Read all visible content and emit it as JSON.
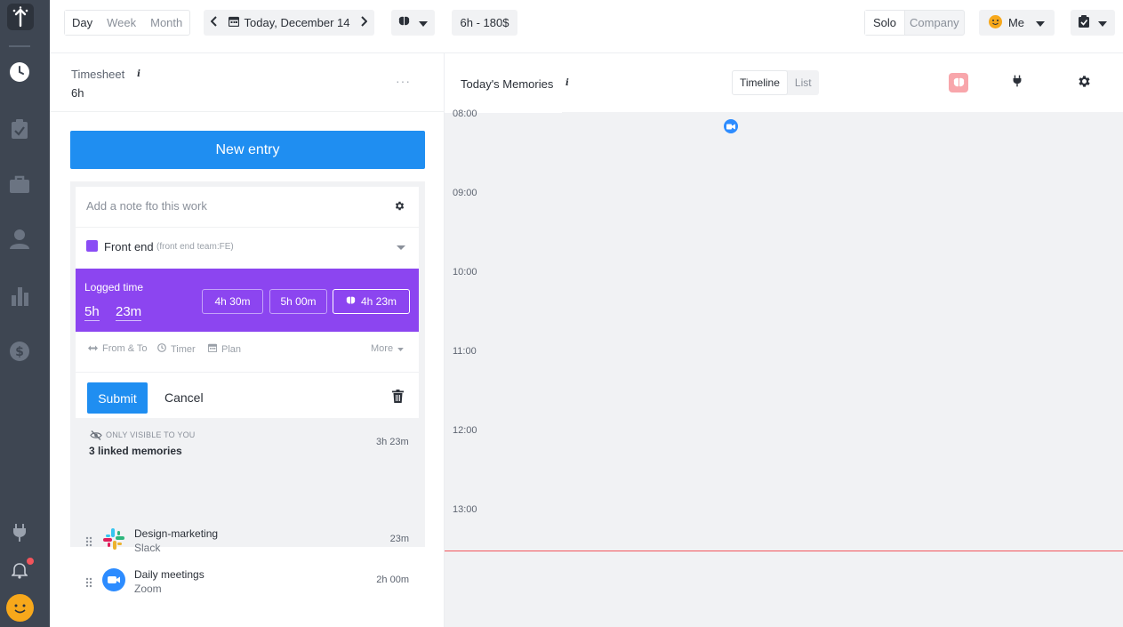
{
  "header": {
    "view_tabs": [
      "Day",
      "Week",
      "Month"
    ],
    "date_label": "Today, December 14",
    "summary": "6h - 180$",
    "scope_tabs": [
      "Solo",
      "Company"
    ],
    "user_label": "Me"
  },
  "timesheet": {
    "title": "Timesheet",
    "info": "i",
    "hours": "6h",
    "more": "···"
  },
  "new_entry_label": "New entry",
  "entry": {
    "note_placeholder": "Add a note fto this work",
    "project_name": "Front end",
    "project_sub": "(front end team:FE)",
    "logged_label": "Logged time",
    "hours": "5h",
    "minutes": "23m",
    "chips": [
      "4h 30m",
      "5h 00m",
      "4h 23m"
    ],
    "modes": [
      "From & To",
      "Timer",
      "Plan"
    ],
    "more_label": "More",
    "submit_label": "Submit",
    "cancel_label": "Cancel"
  },
  "memories_linked": {
    "visibility_text": "ONLY VISIBLE TO YOU",
    "title": "3 linked memories",
    "total": "3h 23m",
    "items": [
      {
        "title": "Design-marketing",
        "source": "Slack",
        "duration": "23m"
      },
      {
        "title": "Daily meetings",
        "source": "Zoom",
        "duration": "2h 00m"
      }
    ]
  },
  "right": {
    "title": "Today's Memories",
    "info": "i",
    "view_tabs": [
      "Timeline",
      "List"
    ],
    "hours": [
      "08:00",
      "09:00",
      "10:00",
      "11:00",
      "12:00",
      "13:00"
    ]
  },
  "colors": {
    "accent_blue": "#1f8ef1",
    "project_purple": "#8c45f0",
    "sidebar": "#3e4652",
    "now_line": "#f2545b"
  }
}
